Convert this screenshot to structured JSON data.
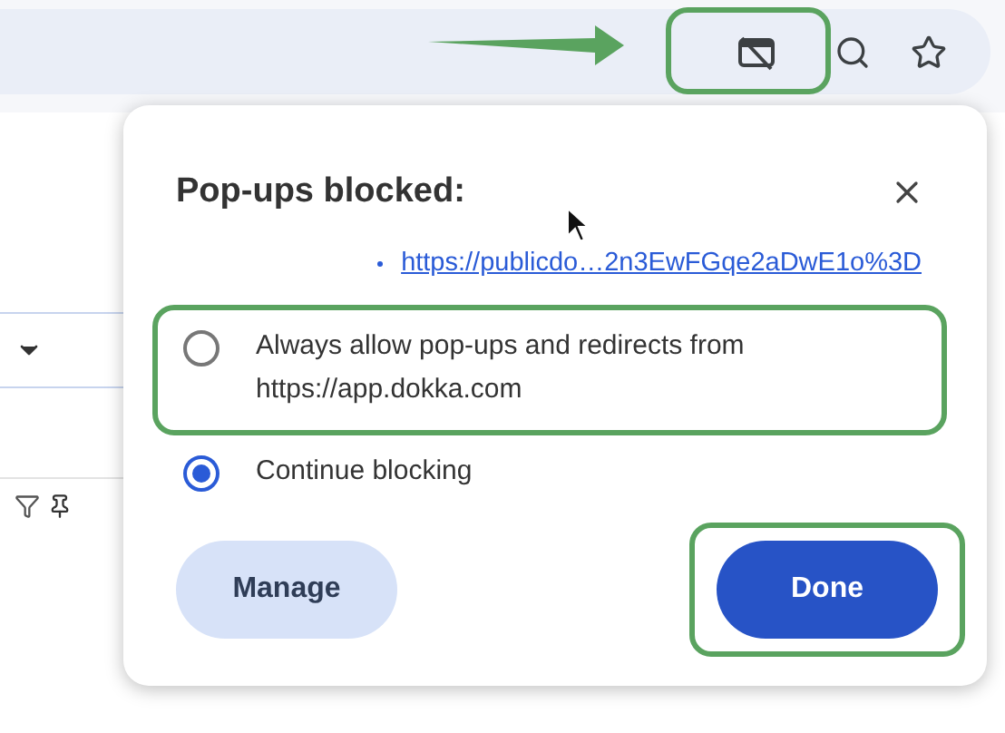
{
  "dialog": {
    "title": "Pop-ups blocked:",
    "blocked_links": [
      "https://publicdo…2n3EwFGqe2aDwE1o%3D"
    ],
    "options": [
      {
        "label": "Always allow pop-ups and redirects from https://app.dokka.com",
        "selected": false,
        "highlighted": true
      },
      {
        "label": "Continue blocking",
        "selected": true,
        "highlighted": false
      }
    ],
    "buttons": [
      {
        "label": "Manage",
        "kind": "secondary",
        "highlighted": false
      },
      {
        "label": "Done",
        "kind": "primary",
        "highlighted": true
      }
    ]
  }
}
